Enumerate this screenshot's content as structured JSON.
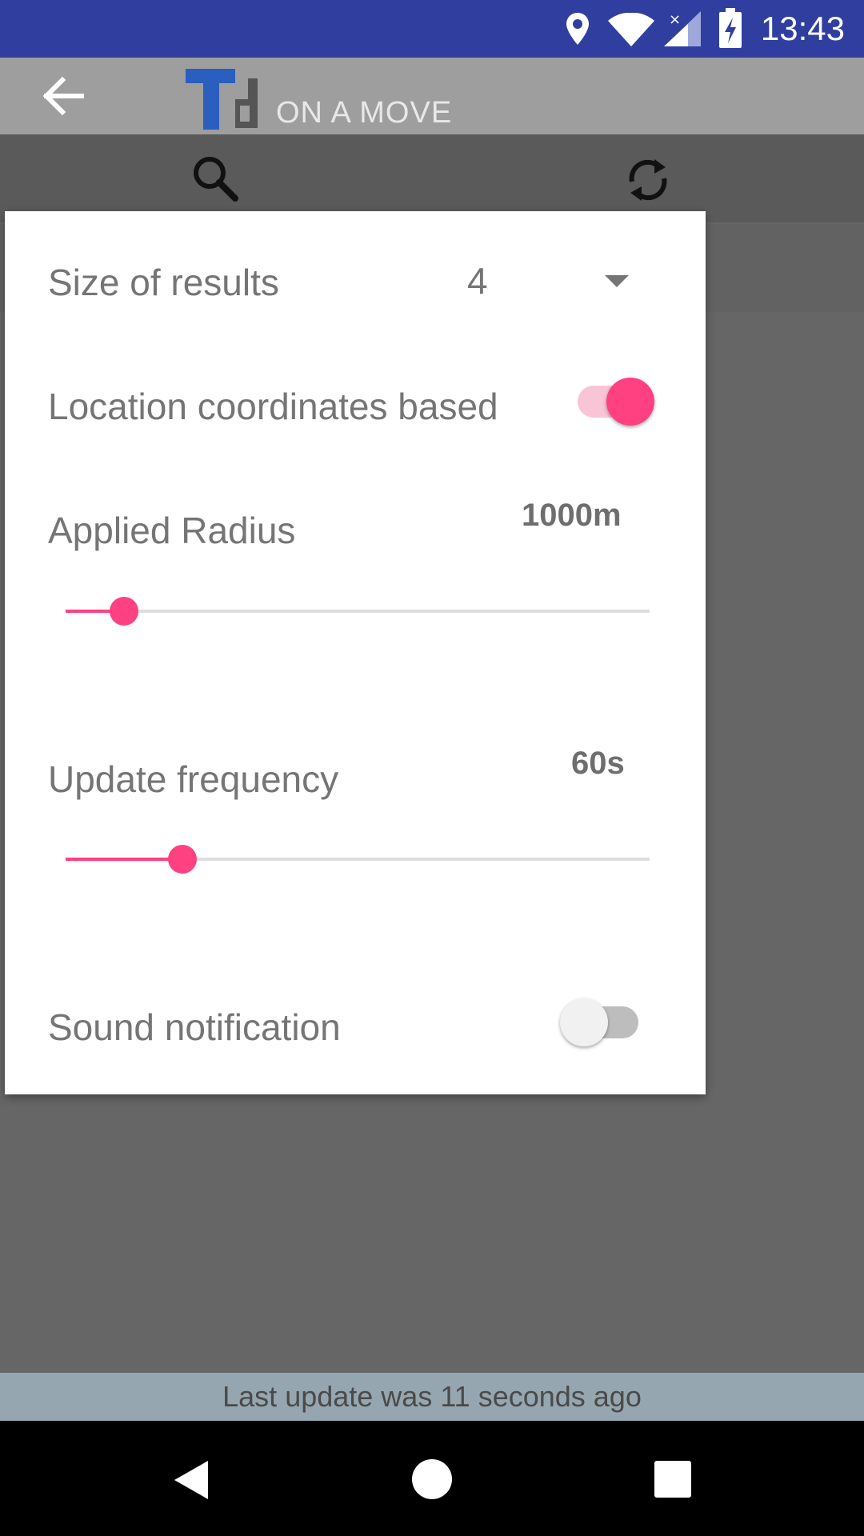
{
  "status_bar": {
    "time": "13:43",
    "icons": [
      "location-icon",
      "wifi-icon",
      "signal-icon",
      "battery-charging-icon"
    ]
  },
  "app_bar": {
    "title": "ON A MOVE",
    "logo_text": "Td",
    "back_icon": "arrow-left-icon",
    "search_icon": "search-icon",
    "refresh_icon": "refresh-icon"
  },
  "dialog": {
    "size_of_results": {
      "label": "Size of results",
      "value": "4"
    },
    "location_coords": {
      "label": "Location coordinates based",
      "enabled": true
    },
    "applied_radius": {
      "label": "Applied Radius",
      "value": "1000m",
      "slider_fraction": 0.1
    },
    "update_frequency": {
      "label": "Update frequency",
      "value": "60s",
      "slider_fraction": 0.2
    },
    "sound_notification": {
      "label": "Sound notification",
      "enabled": false
    }
  },
  "footer": {
    "last_update": "Last update was 11 seconds ago"
  },
  "colors": {
    "accent": "#FF4081",
    "primary_dark": "#303F9F",
    "scrim": "#666666"
  }
}
